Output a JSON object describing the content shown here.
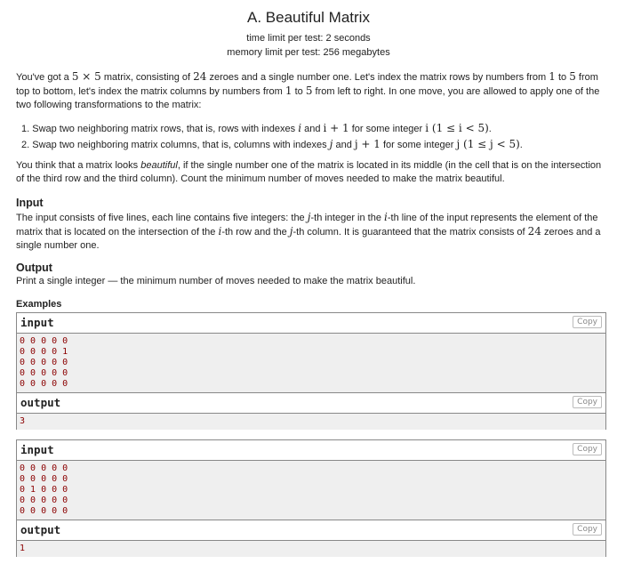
{
  "title": "A. Beautiful Matrix",
  "time_limit": "time limit per test: 2 seconds",
  "memory_limit": "memory limit per test: 256 megabytes",
  "statement": {
    "p1_a": "You've got a ",
    "p1_m1": "5 × 5",
    "p1_b": " matrix, consisting of ",
    "p1_m2": "24",
    "p1_c": " zeroes and a single number one. Let's index the matrix rows by numbers from ",
    "p1_m3": "1",
    "p1_d": " to ",
    "p1_m4": "5",
    "p1_e": " from top to bottom, let's index the matrix columns by numbers from ",
    "p1_m5": "1",
    "p1_f": " to ",
    "p1_m6": "5",
    "p1_g": " from left to right. In one move, you are allowed to apply one of the two following transformations to the matrix:",
    "li1_a": "1. Swap two neighboring matrix rows, that is, rows with indexes ",
    "li1_m1": "i",
    "li1_b": " and ",
    "li1_m2": "i + 1",
    "li1_c": " for some integer ",
    "li1_m3": "i (1 ≤ i < 5)",
    "li1_d": ".",
    "li2_a": "2. Swap two neighboring matrix columns, that is, columns with indexes ",
    "li2_m1": "j",
    "li2_b": " and ",
    "li2_m2": "j + 1",
    "li2_c": " for some integer ",
    "li2_m3": "j (1 ≤ j < 5)",
    "li2_d": ".",
    "p2_a": "You think that a matrix looks ",
    "p2_em": "beautiful",
    "p2_b": ", if the single number one of the matrix is located in its middle (in the cell that is on the intersection of the third row and the third column). Count the minimum number of moves needed to make the matrix beautiful."
  },
  "input_section": {
    "heading": "Input",
    "a": "The input consists of five lines, each line contains five integers: the ",
    "m1": "j",
    "b": "-th integer in the ",
    "m2": "i",
    "c": "-th line of the input represents the element of the matrix that is located on the intersection of the ",
    "m3": "i",
    "d": "-th row and the ",
    "m4": "j",
    "e": "-th column. It is guaranteed that the matrix consists of ",
    "m5": "24",
    "f": " zeroes and a single number one."
  },
  "output_section": {
    "heading": "Output",
    "text": "Print a single integer — the minimum number of moves needed to make the matrix beautiful."
  },
  "examples": {
    "label": "Examples",
    "input_label": "input",
    "output_label": "output",
    "copy_label": "Copy",
    "ex1_input": "0 0 0 0 0\n0 0 0 0 1\n0 0 0 0 0\n0 0 0 0 0\n0 0 0 0 0",
    "ex1_output": "3",
    "ex2_input": "0 0 0 0 0\n0 0 0 0 0\n0 1 0 0 0\n0 0 0 0 0\n0 0 0 0 0",
    "ex2_output": "1"
  }
}
